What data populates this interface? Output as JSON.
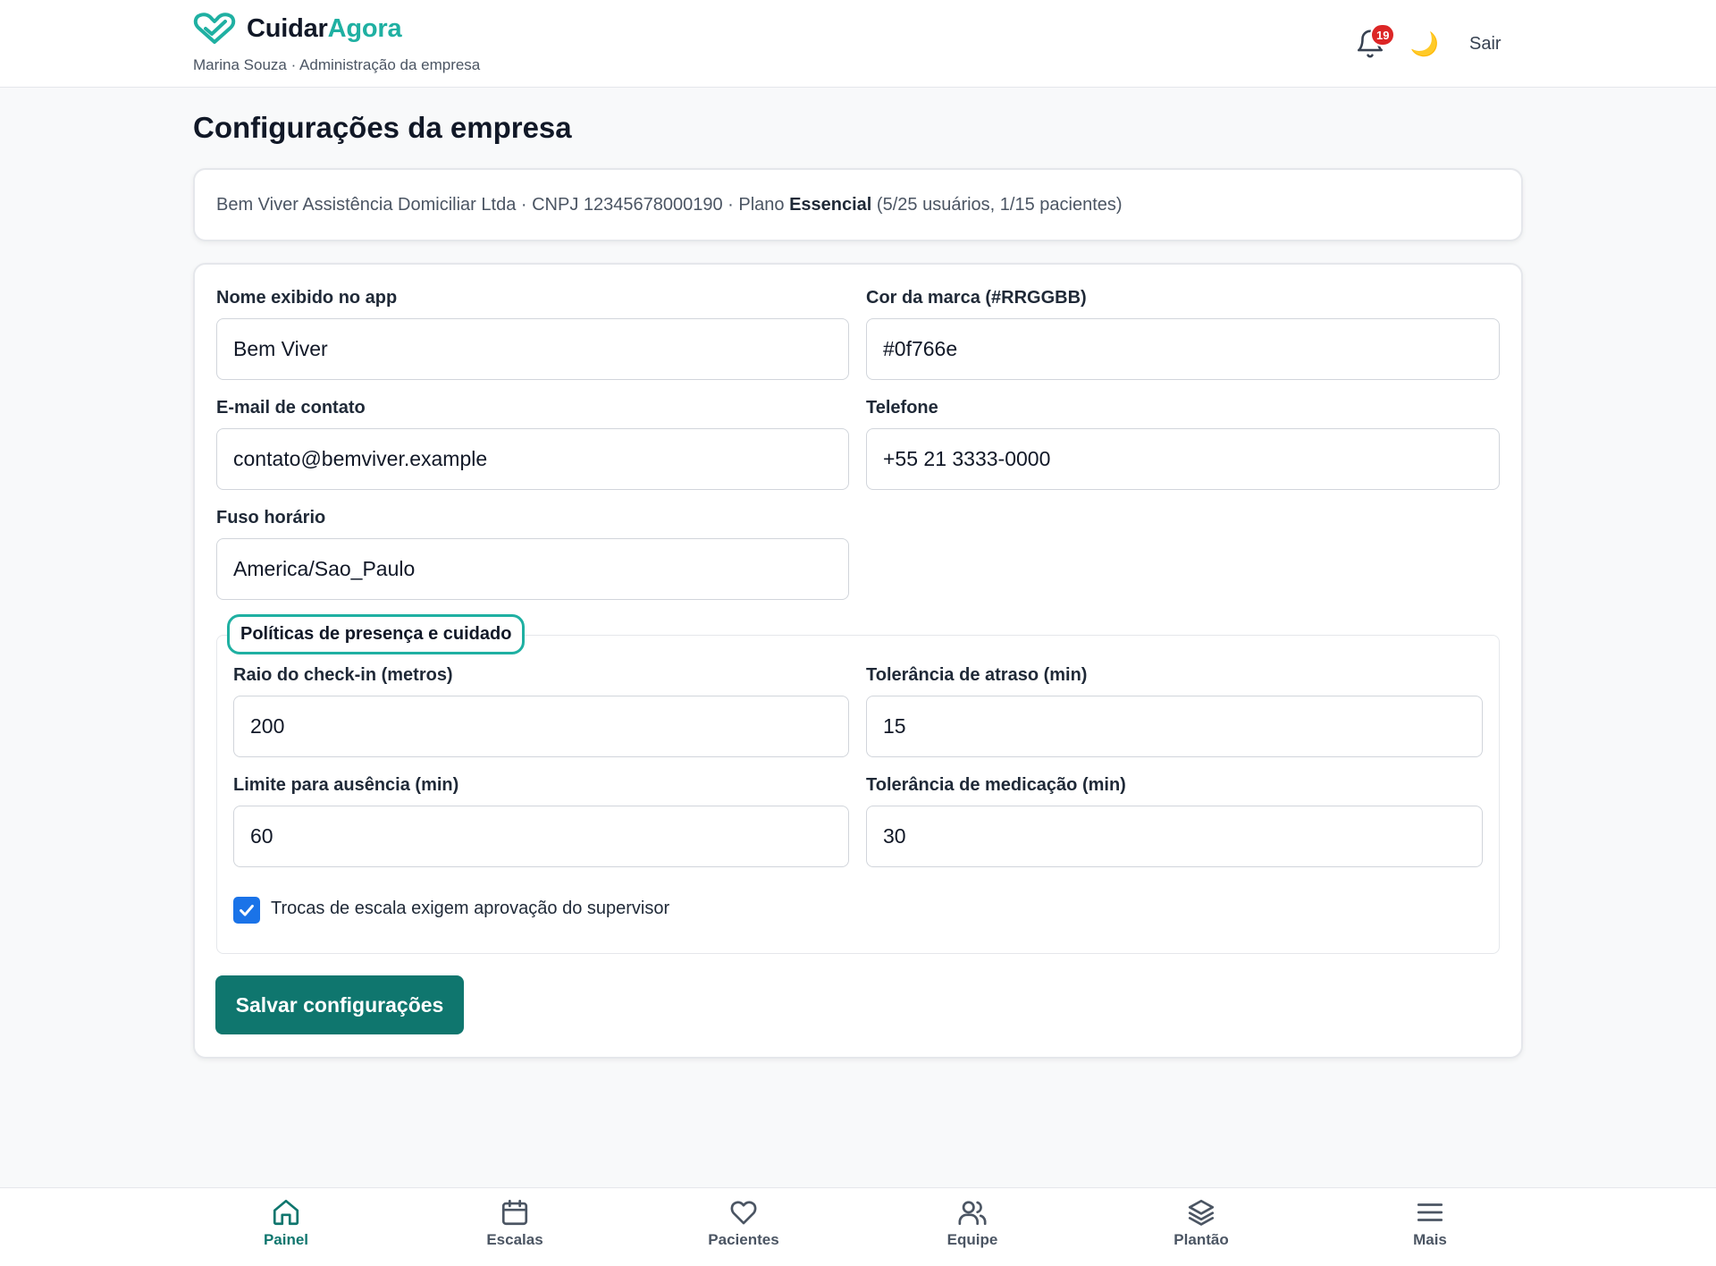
{
  "header": {
    "brand_part1": "Cuidar",
    "brand_part2": "Agora",
    "user_line": "Marina Souza · Administração da empresa",
    "notifications_count": "19",
    "logout_label": "Sair",
    "accent_color": "#1fb0a2"
  },
  "page": {
    "title": "Configurações da empresa"
  },
  "company_info": {
    "prefix": "Bem Viver Assistência Domiciliar Ltda · CNPJ 12345678000190 · Plano ",
    "plan": "Essencial",
    "usage": " (5/25 usuários, 1/15 pacientes)"
  },
  "form": {
    "display_name": {
      "label": "Nome exibido no app",
      "value": "Bem Viver"
    },
    "brand_color": {
      "label": "Cor da marca (#RRGGBB)",
      "value": "#0f766e"
    },
    "email": {
      "label": "E-mail de contato",
      "value": "contato@bemviver.example"
    },
    "phone": {
      "label": "Telefone",
      "value": "+55 21 3333-0000"
    },
    "timezone": {
      "label": "Fuso horário",
      "value": "America/Sao_Paulo"
    },
    "policies": {
      "legend": "Políticas de presença e cuidado",
      "checkin_radius": {
        "label": "Raio do check-in (metros)",
        "value": "200"
      },
      "late_tolerance": {
        "label": "Tolerância de atraso (min)",
        "value": "15"
      },
      "absence_limit": {
        "label": "Limite para ausência (min)",
        "value": "60"
      },
      "medication_tolerance": {
        "label": "Tolerância de medicação (min)",
        "value": "30"
      },
      "swap_approval": {
        "label": "Trocas de escala exigem aprovação do supervisor",
        "checked": true
      }
    },
    "save_label": "Salvar configurações",
    "save_color": "#0f766e"
  },
  "bottom_nav": {
    "items": [
      {
        "label": "Painel",
        "icon": "home-icon",
        "active": true
      },
      {
        "label": "Escalas",
        "icon": "calendar-icon"
      },
      {
        "label": "Pacientes",
        "icon": "heart-icon"
      },
      {
        "label": "Equipe",
        "icon": "users-icon"
      },
      {
        "label": "Plantão",
        "icon": "layers-icon"
      },
      {
        "label": "Mais",
        "icon": "menu-icon"
      }
    ]
  }
}
